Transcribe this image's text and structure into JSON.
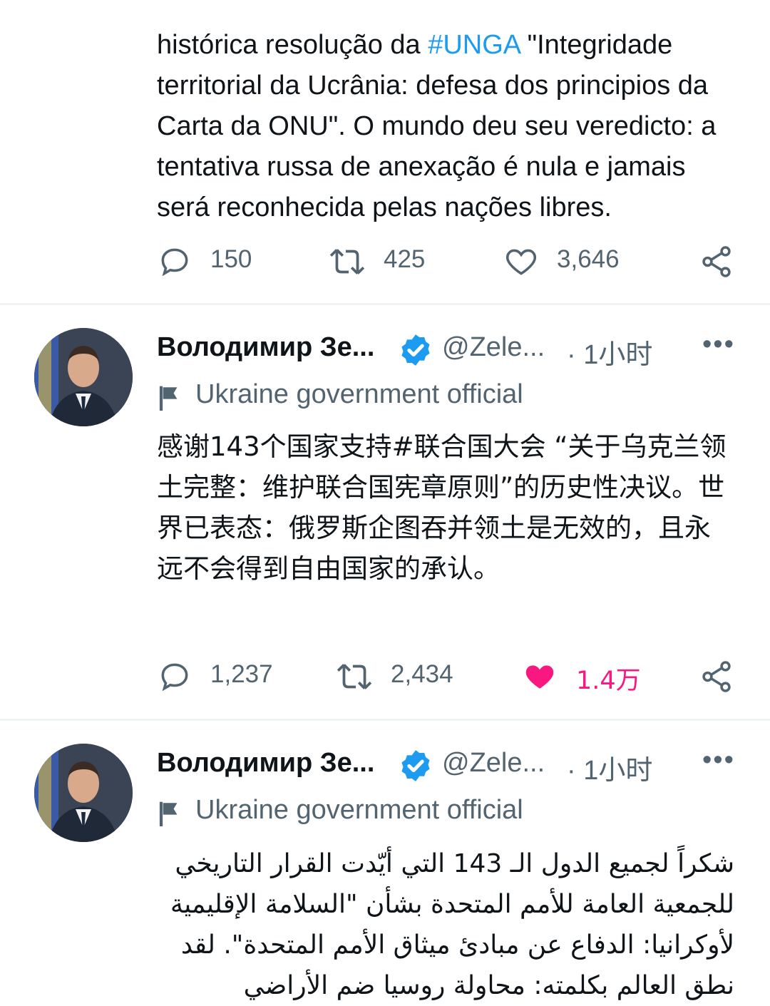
{
  "tweets": [
    {
      "body_lines_pre": "histórica resolução da ",
      "body_link": "#UNGA",
      "body_lines_post": " \"Integridade territorial da Ucrânia: defesa dos principios da Carta da ONU\". O mundo deu seu veredicto: a tentativa russa de anexação é nula e jamais será reconhecida pelas nações libres.",
      "replies": "150",
      "retweets": "425",
      "likes": "3,646",
      "liked": false
    },
    {
      "author_name": "Володимир Зе...",
      "handle": "@Zele...",
      "time": "· 1小时",
      "label": "Ukraine government official",
      "body": "感谢143个国家支持#联合国大会 “关于乌克兰领土完整：维护联合国宪章原则”的历史性决议。世界已表态：俄罗斯企图吞并领土是无效的，且永远不会得到自由国家的承认。",
      "replies": "1,237",
      "retweets": "2,434",
      "likes": "1.4万",
      "liked": true
    },
    {
      "author_name": "Володимир Зе...",
      "handle": "@Zele...",
      "time": "· 1小时",
      "label": "Ukraine government official",
      "body": "شكراً لجميع الدول الـ 143 التي أيّدت القرار التاريخي للجمعية العامة للأمم المتحدة بشأن \"السلامة الإقليمية لأوكرانيا: الدفاع عن مبادئ ميثاق الأمم المتحدة\". لقد نطق العالم بكلمته: محاولة روسيا ضم الأراضي"
    }
  ],
  "colors": {
    "accent": "#1d9bf0",
    "secondary_text": "#536471",
    "like_active": "#f91880",
    "divider": "#eff3f4"
  },
  "icons": {
    "reply": "reply-icon",
    "retweet": "retweet-icon",
    "like": "heart-icon",
    "share": "share-icon",
    "verified": "verified-badge-icon",
    "label": "flag-icon",
    "more": "more-icon"
  }
}
